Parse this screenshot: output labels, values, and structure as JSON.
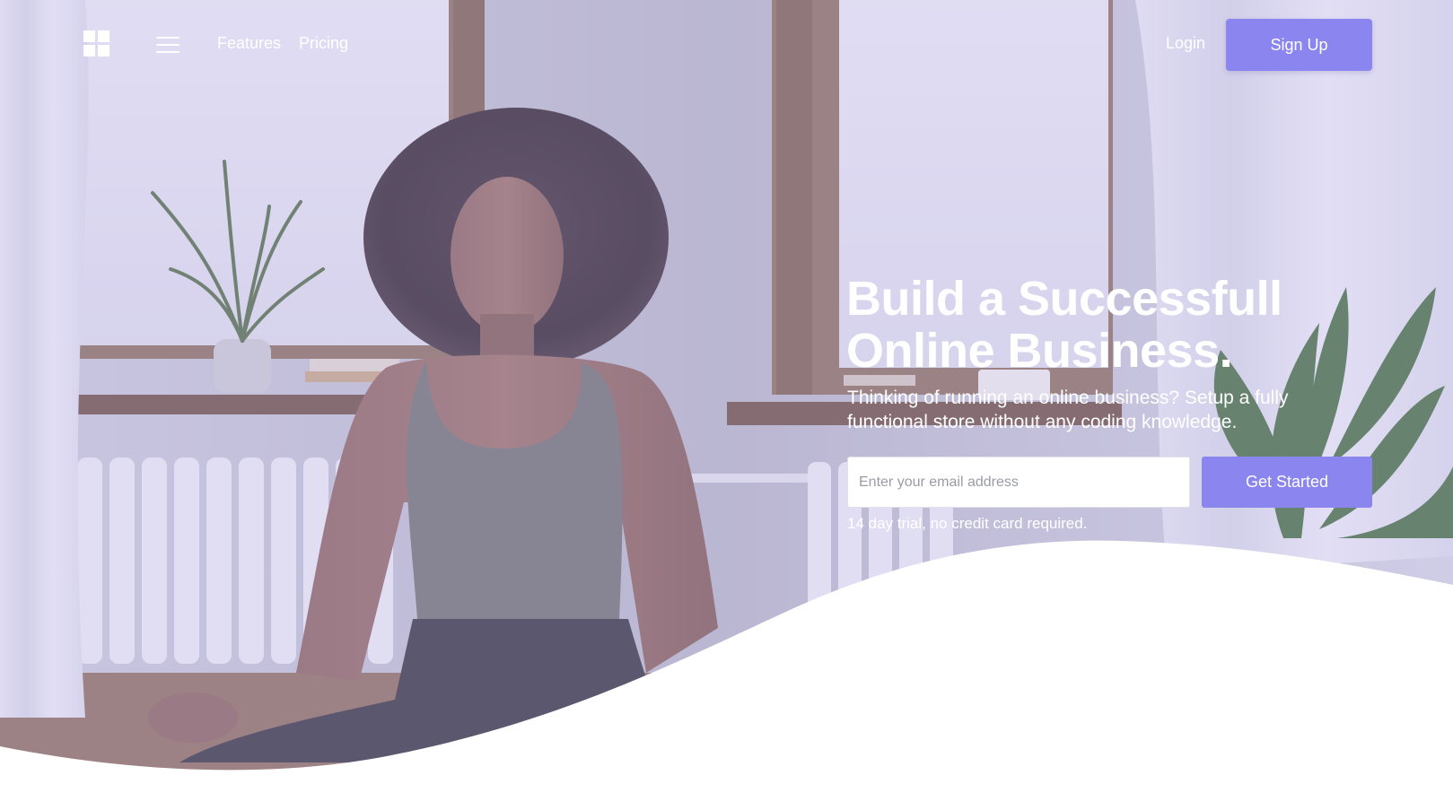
{
  "nav": {
    "logo_icon": "windows-grid-logo-icon",
    "menu_icon": "hamburger-menu-icon",
    "links": [
      {
        "label": "Features"
      },
      {
        "label": "Pricing"
      }
    ],
    "login_label": "Login",
    "signup_label": "Sign Up"
  },
  "hero": {
    "headline_line1": "Build a Successfull",
    "headline_line2": "Online Business.",
    "subtitle": "Thinking of running an online business? Setup a fully functional store without any coding knowledge.",
    "email": {
      "value": "",
      "placeholder": "Enter your email address"
    },
    "cta_label": "Get Started",
    "note": "14 day trial, no credit card required."
  },
  "colors": {
    "accent": "#8b85f0",
    "overlay_tint": "#c9c3f0",
    "text_on_image": "#ffffff",
    "section_bg": "#ffffff"
  }
}
